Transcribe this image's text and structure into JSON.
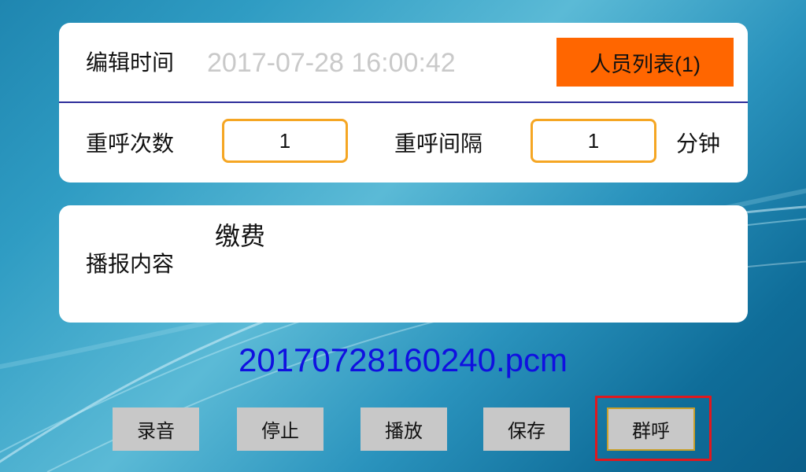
{
  "header": {
    "edit_time_label": "编辑时间",
    "edit_time_value": "2017-07-28 16:00:42",
    "personnel_list_button": "人员列表(1)"
  },
  "retry": {
    "count_label": "重呼次数",
    "count_value": "1",
    "interval_label": "重呼间隔",
    "interval_value": "1",
    "interval_unit": "分钟"
  },
  "broadcast": {
    "label": "播报内容",
    "content": "缴费"
  },
  "recording": {
    "filename": "20170728160240.pcm"
  },
  "actions": {
    "record": "录音",
    "stop": "停止",
    "play": "播放",
    "save": "保存",
    "group_call": "群呼"
  },
  "colors": {
    "accent_orange": "#ff6600",
    "field_border": "#f5a623",
    "filename_blue": "#1010e0",
    "highlight_red": "#e0181e"
  }
}
